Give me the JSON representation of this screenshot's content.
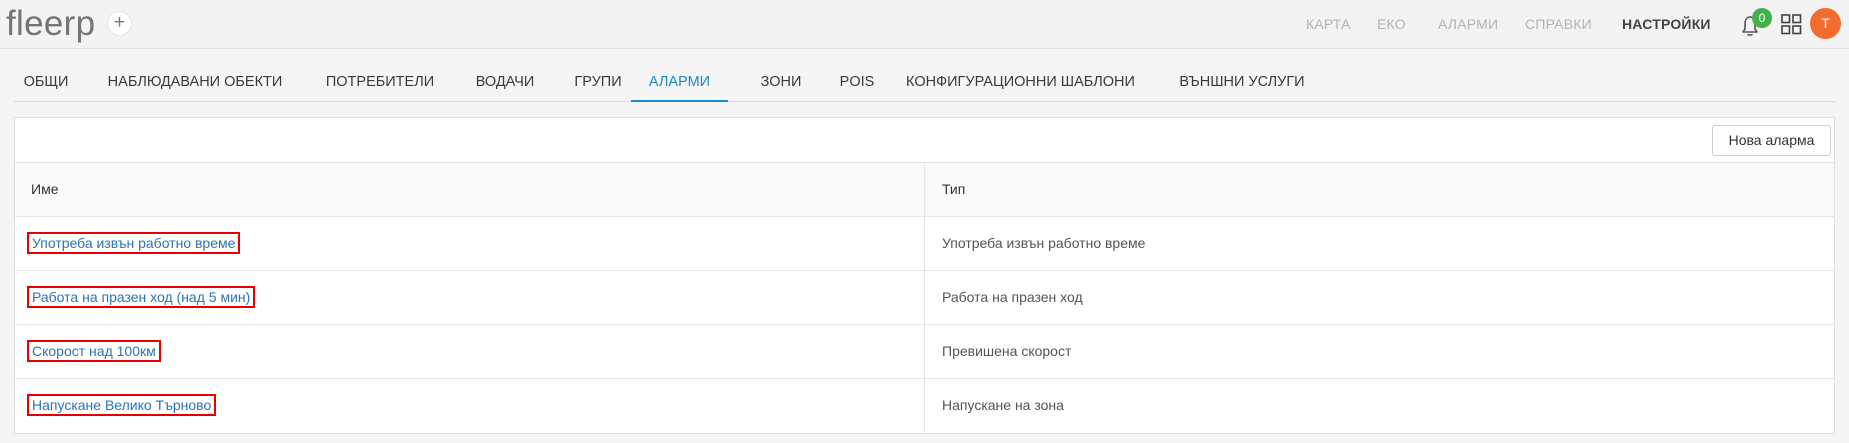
{
  "app": {
    "logo_text": "fleerp",
    "add_symbol": "+"
  },
  "topnav": {
    "items": [
      {
        "label": "КАРТА",
        "active": false
      },
      {
        "label": "ЕКО",
        "active": false
      },
      {
        "label": "АЛАРМИ",
        "active": false
      },
      {
        "label": "СПРАВКИ",
        "active": false
      },
      {
        "label": "НАСТРОЙКИ",
        "active": true
      }
    ],
    "notifications_count": "0",
    "avatar_initial": "T"
  },
  "tabs": [
    {
      "label": "ОБЩИ",
      "active": false
    },
    {
      "label": "НАБЛЮДАВАНИ ОБЕКТИ",
      "active": false
    },
    {
      "label": "ПОТРЕБИТЕЛИ",
      "active": false
    },
    {
      "label": "ВОДАЧИ",
      "active": false
    },
    {
      "label": "ГРУПИ",
      "active": false
    },
    {
      "label": "АЛАРМИ",
      "active": true
    },
    {
      "label": "ЗОНИ",
      "active": false
    },
    {
      "label": "POIS",
      "active": false
    },
    {
      "label": "КОНФИГУРАЦИОННИ ШАБЛОНИ",
      "active": false
    },
    {
      "label": "ВЪНШНИ УСЛУГИ",
      "active": false
    }
  ],
  "panel": {
    "new_button_label": "Нова аларма",
    "columns": {
      "name": "Име",
      "type": "Тип"
    },
    "rows": [
      {
        "name": "Употреба извън работно време",
        "type": "Употреба извън работно време"
      },
      {
        "name": "Работа на празен ход (над 5 мин)",
        "type": "Работа на празен ход"
      },
      {
        "name": "Скорост над 100км",
        "type": "Превишена скорост"
      },
      {
        "name": "Напускане Велико Търново",
        "type": "Напускане на зона"
      }
    ]
  },
  "colors": {
    "accent": "#1e88c7",
    "link": "#2a74b5",
    "badge": "#43b049",
    "avatar": "#f26c2f",
    "highlight_border": "#e60000"
  }
}
